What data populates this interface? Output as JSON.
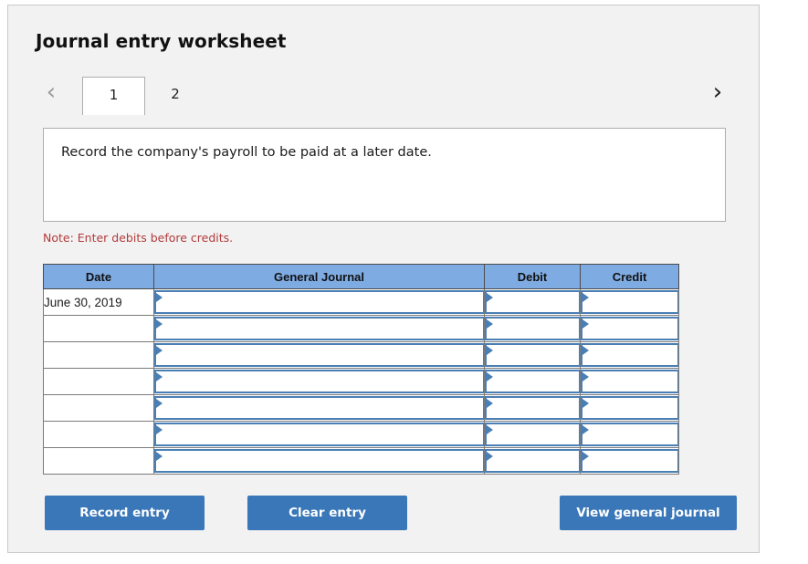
{
  "panel": {
    "title": "Journal entry worksheet"
  },
  "tabs": {
    "prev_arrow": "‹",
    "next_arrow": "›",
    "items": [
      {
        "label": "1",
        "active": true
      },
      {
        "label": "2",
        "active": false
      }
    ]
  },
  "instruction": {
    "text": "Record the company's payroll to be paid at a later date."
  },
  "note": {
    "text": "Note: Enter debits before credits."
  },
  "table": {
    "headers": [
      "Date",
      "General Journal",
      "Debit",
      "Credit"
    ],
    "rows": [
      {
        "date": "June 30, 2019",
        "general_journal": "",
        "debit": "",
        "credit": ""
      },
      {
        "date": "",
        "general_journal": "",
        "debit": "",
        "credit": ""
      },
      {
        "date": "",
        "general_journal": "",
        "debit": "",
        "credit": ""
      },
      {
        "date": "",
        "general_journal": "",
        "debit": "",
        "credit": ""
      },
      {
        "date": "",
        "general_journal": "",
        "debit": "",
        "credit": ""
      },
      {
        "date": "",
        "general_journal": "",
        "debit": "",
        "credit": ""
      },
      {
        "date": "",
        "general_journal": "",
        "debit": "",
        "credit": ""
      }
    ]
  },
  "buttons": {
    "record_entry": "Record entry",
    "clear_entry": "Clear entry",
    "view_general_journal": "View general journal"
  },
  "colors": {
    "panel_background": "#f2f2f2",
    "panel_border": "#c9c9c9",
    "button_blue": "#3a77b8",
    "table_header_blue": "#7fabe3",
    "input_border_blue": "#4a7fb5",
    "note_red": "#b33a3a"
  }
}
